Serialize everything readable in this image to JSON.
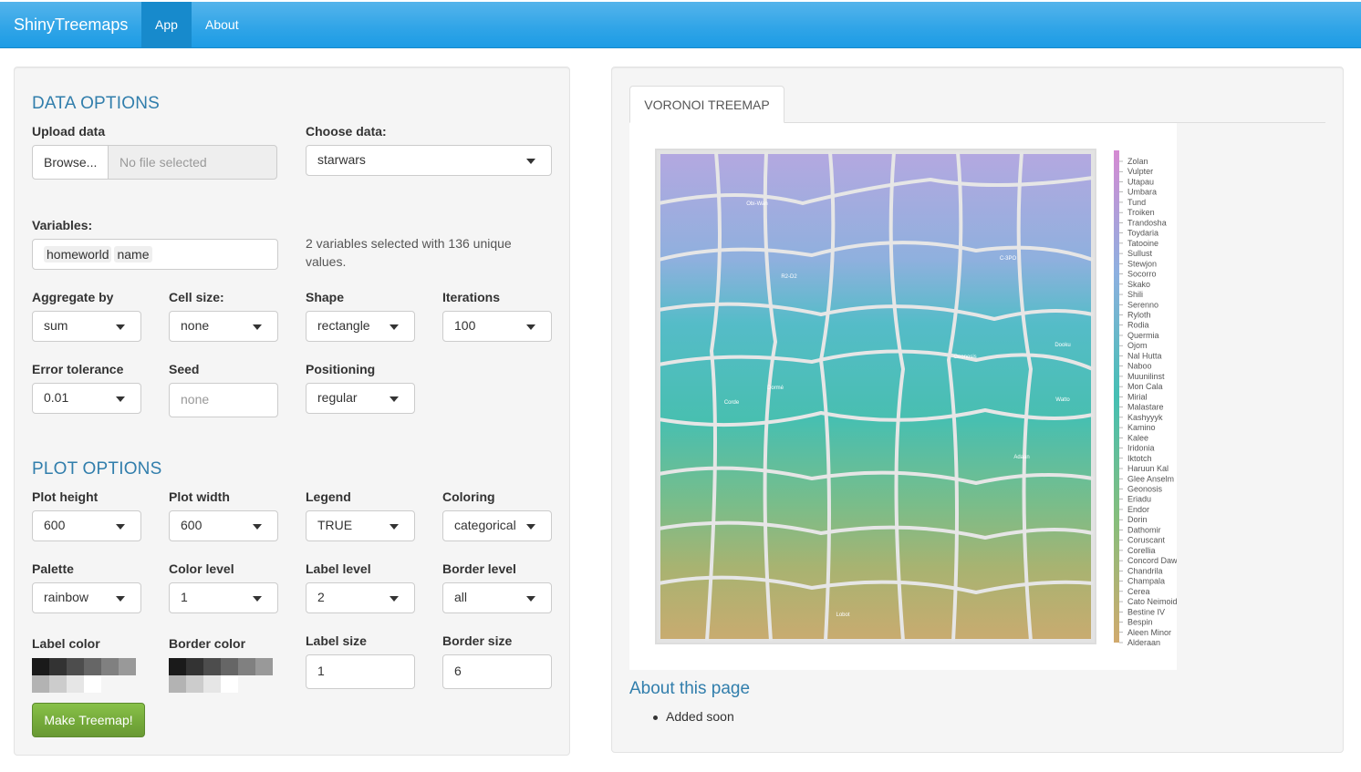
{
  "navbar": {
    "brand": "ShinyTreemaps",
    "tabs": [
      {
        "label": "App",
        "active": true
      },
      {
        "label": "About",
        "active": false
      }
    ],
    "color": "#2fa4e7"
  },
  "data_options": {
    "title": "DATA OPTIONS",
    "upload": {
      "label": "Upload data",
      "browse": "Browse...",
      "placeholder": "No file selected"
    },
    "choose": {
      "label": "Choose data:",
      "value": "starwars"
    },
    "variables": {
      "label": "Variables:",
      "tags": [
        "homeworld",
        "name"
      ],
      "help": "2 variables selected with 136 unique",
      "help2": "values."
    },
    "aggregate": {
      "label": "Aggregate by",
      "value": "sum"
    },
    "cell_size": {
      "label": "Cell size:",
      "value": "none"
    },
    "shape": {
      "label": "Shape",
      "value": "rectangle"
    },
    "iterations": {
      "label": "Iterations",
      "value": "100"
    },
    "error_tolerance": {
      "label": "Error tolerance",
      "value": "0.01"
    },
    "seed": {
      "label": "Seed",
      "placeholder": "none"
    },
    "positioning": {
      "label": "Positioning",
      "value": "regular"
    }
  },
  "plot_options": {
    "title": "PLOT OPTIONS",
    "plot_height": {
      "label": "Plot height",
      "value": "600"
    },
    "plot_width": {
      "label": "Plot width",
      "value": "600"
    },
    "legend": {
      "label": "Legend",
      "value": "TRUE"
    },
    "coloring": {
      "label": "Coloring",
      "value": "categorical"
    },
    "palette": {
      "label": "Palette",
      "value": "rainbow"
    },
    "color_level": {
      "label": "Color level",
      "value": "1"
    },
    "label_level": {
      "label": "Label level",
      "value": "2"
    },
    "border_level": {
      "label": "Border level",
      "value": "all"
    },
    "label_color": {
      "label": "Label color",
      "swatches": [
        "#1a1a1a",
        "#333333",
        "#4d4d4d",
        "#666666",
        "#808080",
        "#999999",
        "#b3b3b3",
        "#cccccc",
        "#e6e6e6",
        "#ffffff"
      ]
    },
    "border_color": {
      "label": "Border color",
      "swatches": [
        "#1a1a1a",
        "#333333",
        "#4d4d4d",
        "#666666",
        "#808080",
        "#999999",
        "#b3b3b3",
        "#cccccc",
        "#e6e6e6",
        "#ffffff"
      ]
    },
    "label_size": {
      "label": "Label size",
      "value": "1"
    },
    "border_size": {
      "label": "Border size",
      "value": "6"
    },
    "button": "Make Treemap!"
  },
  "plot_panel": {
    "tab": "VORONOI TREEMAP",
    "cell_labels": [
      "Obi-Wan",
      "C-3PO",
      "R2-D2",
      "Dooku",
      "Watto",
      "Dormé",
      "Lobot",
      "Geonosis",
      "Adaan",
      "Corde"
    ],
    "legend": [
      "Zolan",
      "Vulpter",
      "Utapau",
      "Umbara",
      "Tund",
      "Troiken",
      "Trandosha",
      "Toydaria",
      "Tatooine",
      "Sullust",
      "Stewjon",
      "Socorro",
      "Skako",
      "Shili",
      "Serenno",
      "Ryloth",
      "Rodia",
      "Quermia",
      "Ojom",
      "Nal Hutta",
      "Naboo",
      "Muunilinst",
      "Mon Cala",
      "Mirial",
      "Malastare",
      "Kashyyyk",
      "Kamino",
      "Kalee",
      "Iridonia",
      "Iktotch",
      "Haruun Kal",
      "Glee Anselm",
      "Geonosis",
      "Eriadu",
      "Endor",
      "Dorin",
      "Dathomir",
      "Coruscant",
      "Corellia",
      "Concord Dawn",
      "Chandrila",
      "Champala",
      "Cerea",
      "Cato Neimoidia",
      "Bestine IV",
      "Bespin",
      "Aleen Minor",
      "Alderaan"
    ]
  },
  "about": {
    "title": "About this page",
    "items": [
      "Added soon"
    ]
  }
}
